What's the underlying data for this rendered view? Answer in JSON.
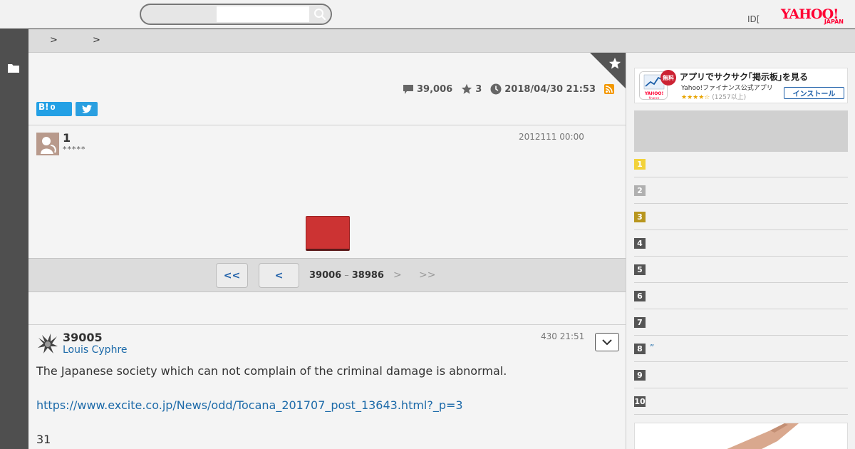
{
  "header": {
    "search_placeholder": "",
    "id_label": "ID[",
    "logo_main": "YAHOO!",
    "logo_sub": "JAPAN"
  },
  "breadcrumb": {
    "separators": [
      ">",
      ">"
    ]
  },
  "thread": {
    "comment_count": "39,006",
    "favorite_count": "3",
    "updated": "2018/04/30 21:53",
    "hatena_label": "B!",
    "hatena_count": "0"
  },
  "first_post": {
    "number": "1",
    "date": "2012111 00:00",
    "rating": "*****"
  },
  "pager": {
    "first": "<<",
    "prev": "<",
    "range_start": "39006",
    "range_sep": "–",
    "range_end": "38986",
    "next": ">",
    "last": ">>"
  },
  "post": {
    "number": "39005",
    "date": "430 21:51",
    "author": "Louis Cyphre",
    "body_line1": "The Japanese society which can not complain of the criminal damage is abnormal.",
    "link": "https://www.excite.co.jp/News/odd/Tocana_201707_post_13643.html?_p=3",
    "body_line3": "31"
  },
  "sidebar": {
    "app_banner": {
      "badge": "無料",
      "title": "アプリでサクサク｢掲示板｣を見る",
      "subtitle": "Yahoo!ファイナンス公式アプリ",
      "stars": "★★★★☆",
      "reviews": "(1257以上)",
      "install": "インストール"
    },
    "ranking": [
      {
        "rank": "1",
        "label": "",
        "color": "#f2d23a"
      },
      {
        "rank": "2",
        "label": "",
        "color": "#b0b0b0"
      },
      {
        "rank": "3",
        "label": "",
        "color": "#b8961e"
      },
      {
        "rank": "4",
        "label": "",
        "color": "#555555"
      },
      {
        "rank": "5",
        "label": "",
        "color": "#555555"
      },
      {
        "rank": "6",
        "label": "",
        "color": "#555555"
      },
      {
        "rank": "7",
        "label": "",
        "color": "#555555"
      },
      {
        "rank": "8",
        "label": "”",
        "color": "#555555"
      },
      {
        "rank": "9",
        "label": "",
        "color": "#555555"
      },
      {
        "rank": "10",
        "label": "",
        "color": "#555555"
      }
    ]
  }
}
